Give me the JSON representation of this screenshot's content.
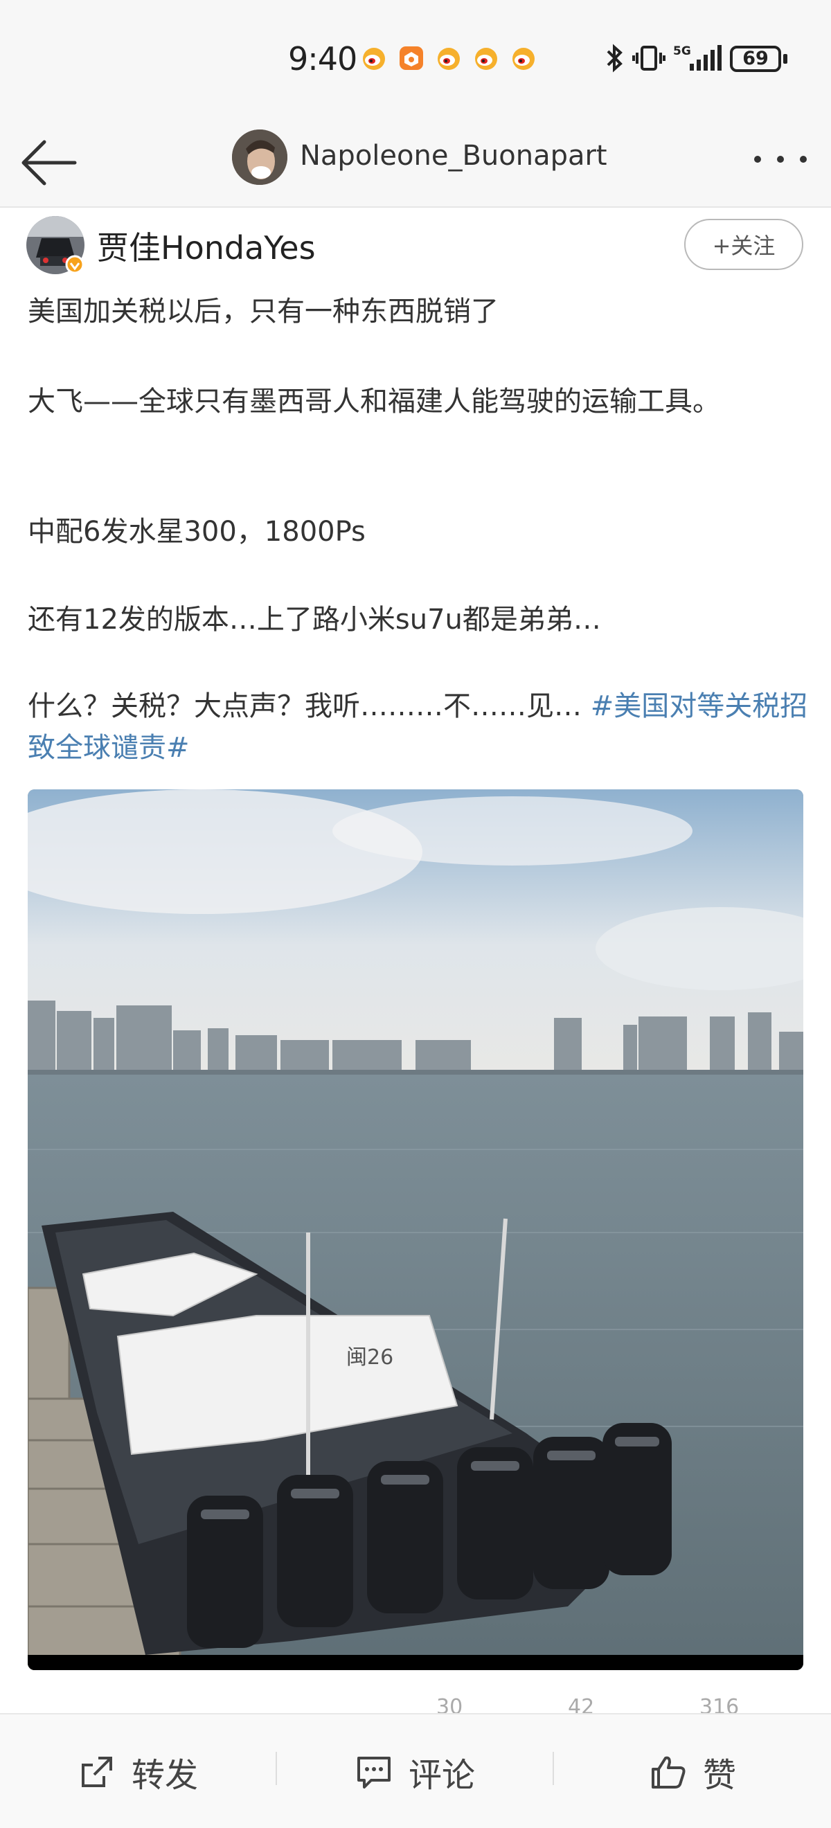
{
  "status_bar": {
    "time": "9:40",
    "notifications": [
      "weibo-icon",
      "app-icon",
      "weibo-icon",
      "weibo-icon",
      "weibo-icon"
    ],
    "network": "5G",
    "battery": "69"
  },
  "header": {
    "title": "Napoleone_Buonapart"
  },
  "post": {
    "author": "贾佳HondaYes",
    "follow_label": "+关注",
    "lines": [
      "美国加关税以后，只有一种东西脱销了",
      "大飞——全球只有墨西哥人和福建人能驾驶的运输工具。",
      "中配6发水星300，1800Ps",
      "还有12发的版本…上了路小米su7u都是弟弟…"
    ],
    "last_line": "什么？关税？大点声？我听………不……见… ",
    "hashtag": "#美国对等关税招致全球谴责#",
    "image_text": "闽26"
  },
  "stats": {
    "repost_count": "30",
    "comment_count": "42",
    "like_count": "316"
  },
  "actions": {
    "repost": "转发",
    "comment": "评论",
    "like": "赞"
  },
  "colors": {
    "link": "#4a7fb1",
    "background": "#ffffff"
  }
}
